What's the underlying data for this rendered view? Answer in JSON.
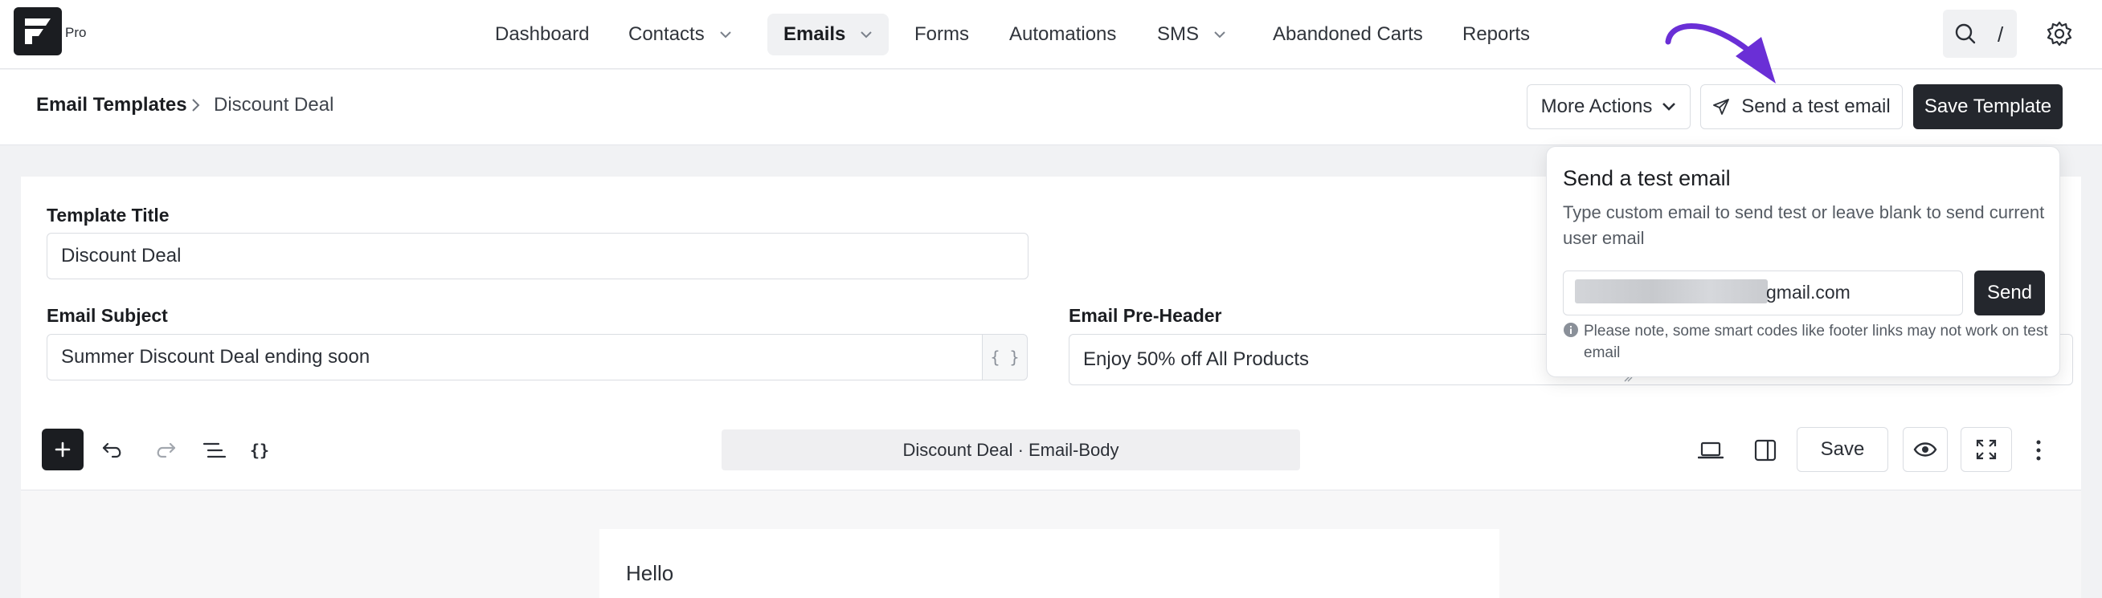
{
  "app": {
    "pro_badge": "Pro"
  },
  "nav": {
    "items": [
      {
        "label": "Dashboard"
      },
      {
        "label": "Contacts"
      },
      {
        "label": "Emails"
      },
      {
        "label": "Forms"
      },
      {
        "label": "Automations"
      },
      {
        "label": "SMS"
      },
      {
        "label": "Abandoned Carts"
      },
      {
        "label": "Reports"
      }
    ],
    "search_shortcut": "/"
  },
  "breadcrumb": {
    "root": "Email Templates",
    "current": "Discount Deal"
  },
  "actions": {
    "more_actions": "More Actions",
    "send_test": "Send a test email",
    "save_template": "Save Template"
  },
  "form": {
    "template_title_label": "Template Title",
    "template_title_value": "Discount Deal",
    "subject_label": "Email Subject",
    "subject_value": "Summer Discount Deal ending soon",
    "smartcode_glyph": "{ }",
    "preheader_label": "Email Pre-Header",
    "preheader_value": "Enjoy 50% off All Products"
  },
  "editor": {
    "doc_title": "Discount Deal · Email-Body",
    "save_label": "Save",
    "code_glyph": "{}",
    "body_text": "Hello"
  },
  "popover": {
    "title": "Send a test email",
    "description": "Type custom email to send test or leave blank to send current user email",
    "email_visible": "gmail.com",
    "send_label": "Send",
    "note": "Please note, some smart codes like footer links may not work on test email"
  },
  "colors": {
    "accent_arrow": "#6a2fd6",
    "primary_dark": "#24272d"
  }
}
